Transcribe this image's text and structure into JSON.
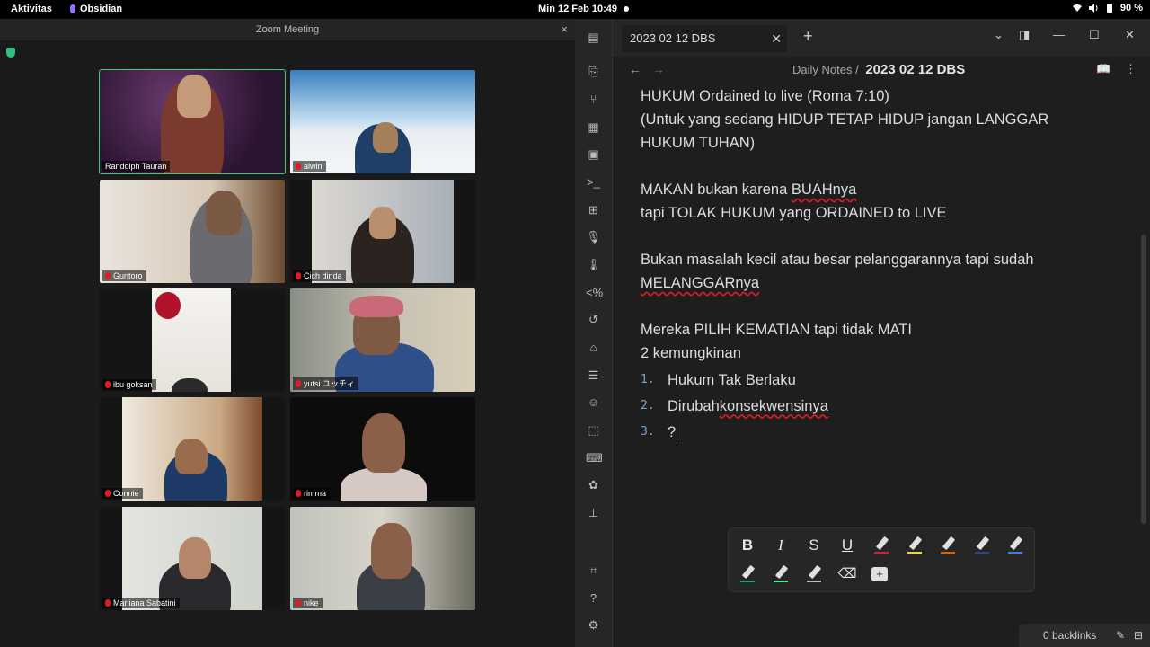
{
  "topbar": {
    "activities": "Aktivitas",
    "app": "Obsidian",
    "clock": "Min 12 Feb  10:49",
    "battery": "90 %"
  },
  "zoom": {
    "title": "Zoom Meeting",
    "close": "×",
    "participants": [
      {
        "name": "Randolph Tauran",
        "muted": false
      },
      {
        "name": "alwin",
        "muted": true
      },
      {
        "name": "Guntoro",
        "muted": true
      },
      {
        "name": "Cich dinda",
        "muted": true
      },
      {
        "name": "ibu goksan",
        "muted": true
      },
      {
        "name": "yutsi ユッチィ",
        "muted": true
      },
      {
        "name": "Connie",
        "muted": true
      },
      {
        "name": "rimma",
        "muted": true
      },
      {
        "name": "Marliana Sabatini",
        "muted": true
      },
      {
        "name": "nike",
        "muted": true
      }
    ]
  },
  "obsidian": {
    "tab_title": "2023 02 12 DBS",
    "breadcrumb_parent": "Daily Notes",
    "breadcrumb_sep": "/",
    "breadcrumb_current": "2023 02 12 DBS",
    "content": {
      "l1": "HUKUM Ordained to live (Roma 7:10)",
      "l2": "(Untuk yang sedang HIDUP TETAP HIDUP jangan LANGGAR",
      "l3": "HUKUM TUHAN)",
      "l4_a": "MAKAN bukan karena ",
      "l4_b": "BUAHnya",
      "l5": "tapi TOLAK HUKUM yang ORDAINED to LIVE",
      "l6": "Bukan masalah kecil atau besar pelanggarannya tapi sudah",
      "l7": "MELANGGARnya",
      "l8": "Mereka PILIH KEMATIAN tapi tidak MATI",
      "l9": "2 kemungkinan",
      "list": [
        {
          "num": "1.",
          "text": "Hukum Tak Berlaku"
        },
        {
          "num": "2.",
          "text_a": "Dirubah ",
          "text_b": "konsekwensinya"
        },
        {
          "num": "3.",
          "text": "?"
        }
      ]
    },
    "toolbar": {
      "bold": "B",
      "italic": "I",
      "strike": "S",
      "underline": "U"
    },
    "status": {
      "backlinks": "0 backlinks"
    },
    "colors": {
      "red": "#e01b24",
      "yellow": "#f6d32d",
      "orange": "#e66100",
      "dark_blue": "#1c4f8a",
      "blue": "#3584e4",
      "green": "#26a269",
      "light_green": "#57e389",
      "gray": "#c0bfbc"
    }
  }
}
